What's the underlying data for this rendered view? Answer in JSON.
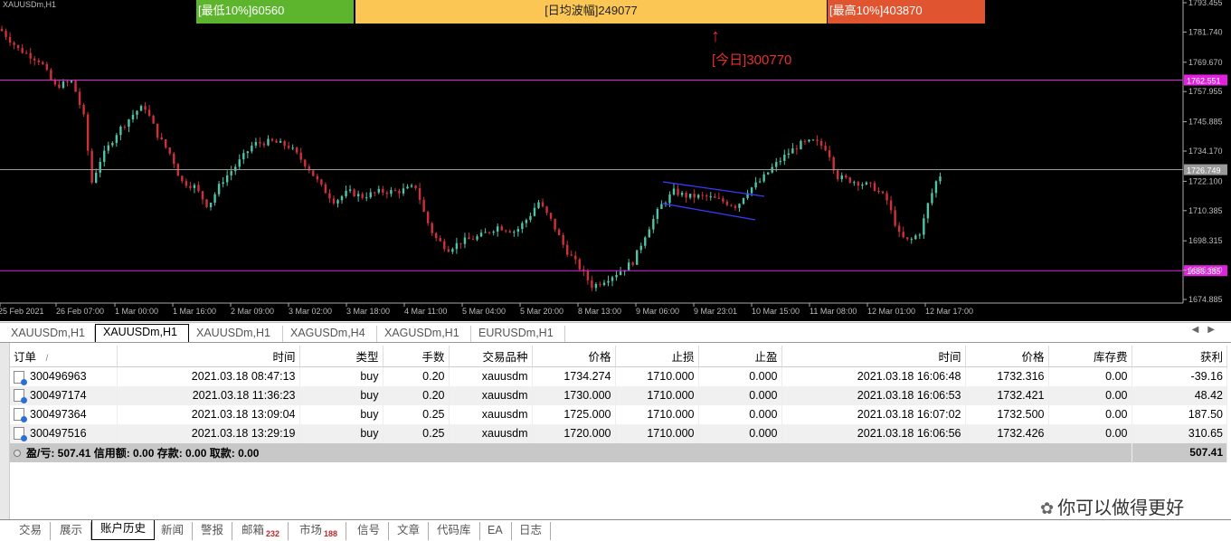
{
  "chart": {
    "symbol": "XAUUSDm,H1",
    "stat_low": "[最低10%]60560",
    "stat_avg": "[日均波幅]249077",
    "stat_high": "[最高10%]403870",
    "today_arrow": "↑",
    "today_label": "[今日]300770",
    "price_labels": [
      "1793.455",
      "1781.740",
      "1769.670",
      "1757.955",
      "1745.885",
      "1734.170",
      "1722.100",
      "1710.385",
      "1698.315",
      "1686.600",
      "1674.885"
    ],
    "price_min": 1674.885,
    "price_max": 1793.455,
    "hlines": [
      {
        "price": 1762.551,
        "label": "1762.551",
        "color": "#e022e0"
      },
      {
        "price": 1726.749,
        "label": "1726.749",
        "color": "#9a9a9a"
      },
      {
        "price": 1686.385,
        "label": "1686.385",
        "color": "#e022e0"
      }
    ],
    "time_labels": [
      "25 Feb 2021",
      "26 Feb 07:00",
      "1 Mar 00:00",
      "1 Mar 16:00",
      "2 Mar 09:00",
      "3 Mar 02:00",
      "3 Mar 18:00",
      "4 Mar 11:00",
      "5 Mar 04:00",
      "5 Mar 20:00",
      "8 Mar 13:00",
      "9 Mar 06:00",
      "9 Mar 23:01",
      "10 Mar 15:00",
      "11 Mar 08:00",
      "12 Mar 01:00",
      "12 Mar 17:00"
    ],
    "bull_color": "#4fc4a8",
    "bear_color": "#d0303a",
    "channel_color": "#3b3bff"
  },
  "chart_tabs": [
    "XAUUSDm,H1",
    "XAUUSDm,H1",
    "XAUUSDm,H1",
    "XAGUSDm,H4",
    "XAGUSDm,H1",
    "EURUSDm,H1"
  ],
  "scroll_arrows": "◀▶",
  "table": {
    "headers": [
      "订单",
      "时间",
      "类型",
      "手数",
      "交易品种",
      "价格",
      "止损",
      "止盈",
      "时间",
      "价格",
      "库存费",
      "获利"
    ],
    "sort_mark": "/",
    "rows": [
      [
        "300496963",
        "2021.03.18 08:47:13",
        "buy",
        "0.20",
        "xauusdm",
        "1734.274",
        "1710.000",
        "0.000",
        "2021.03.18 16:06:48",
        "1732.316",
        "0.00",
        "-39.16"
      ],
      [
        "300497174",
        "2021.03.18 11:36:23",
        "buy",
        "0.20",
        "xauusdm",
        "1730.000",
        "1710.000",
        "0.000",
        "2021.03.18 16:06:53",
        "1732.421",
        "0.00",
        "48.42"
      ],
      [
        "300497364",
        "2021.03.18 13:09:04",
        "buy",
        "0.25",
        "xauusdm",
        "1725.000",
        "1710.000",
        "0.000",
        "2021.03.18 16:07:02",
        "1732.500",
        "0.00",
        "187.50"
      ],
      [
        "300497516",
        "2021.03.18 13:29:19",
        "buy",
        "0.25",
        "xauusdm",
        "1720.000",
        "1710.000",
        "0.000",
        "2021.03.18 16:06:56",
        "1732.426",
        "0.00",
        "310.65"
      ]
    ],
    "summary": "盈/亏: 507.41  信用额: 0.00  存款: 0.00  取款: 0.00",
    "summary_total": "507.41"
  },
  "bottom_tabs": [
    {
      "label": "交易"
    },
    {
      "label": "展示"
    },
    {
      "label": "账户历史"
    },
    {
      "label": "新闻"
    },
    {
      "label": "警报"
    },
    {
      "label": "邮箱",
      "badge": "232"
    },
    {
      "label": "市场",
      "badge": "188"
    },
    {
      "label": "信号"
    },
    {
      "label": "文章"
    },
    {
      "label": "代码库"
    },
    {
      "label": "EA"
    },
    {
      "label": "日志"
    }
  ],
  "watermark": "你可以做得更好"
}
